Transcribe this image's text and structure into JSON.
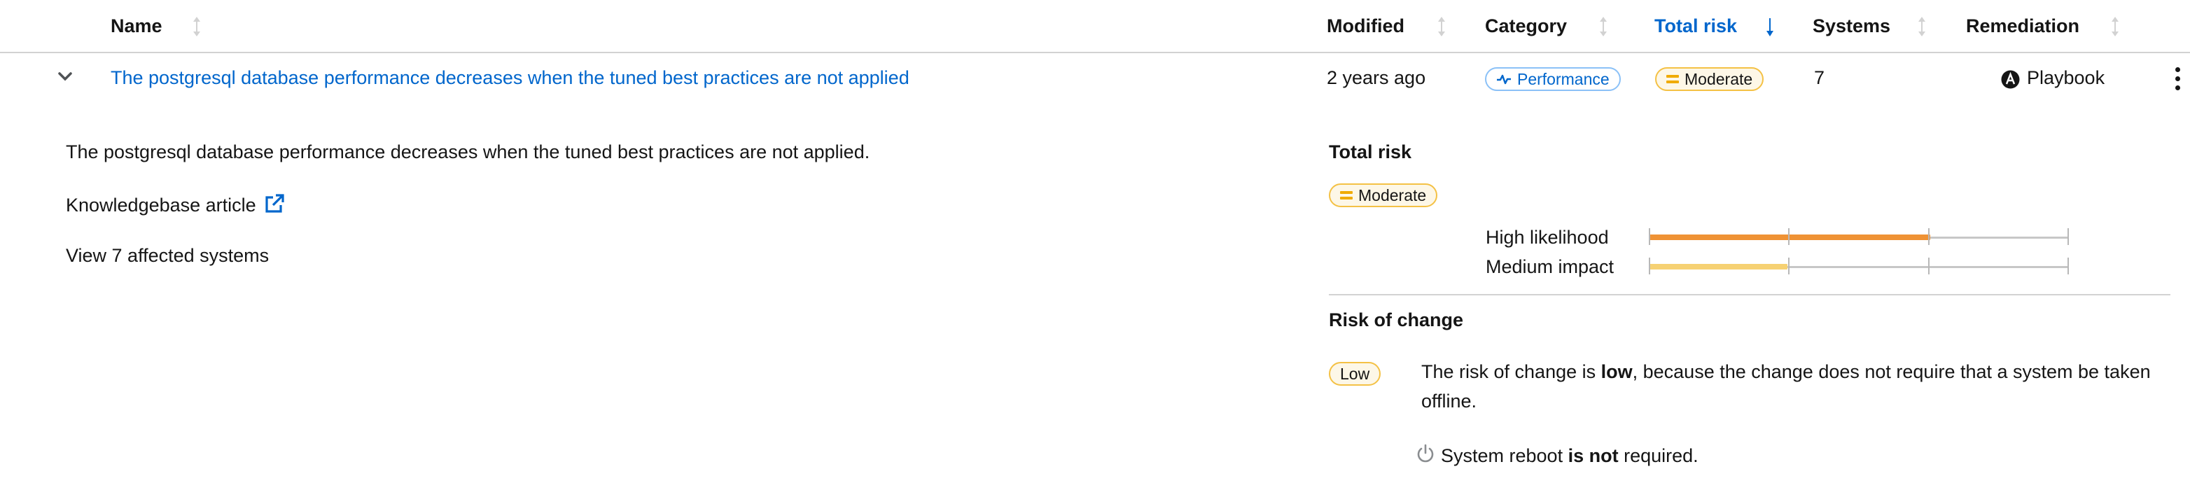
{
  "table": {
    "columns": {
      "name": "Name",
      "modified": "Modified",
      "category": "Category",
      "total_risk": "Total risk",
      "systems": "Systems",
      "remediation": "Remediation"
    },
    "sorted_column": "Total risk",
    "sort_direction": "descending"
  },
  "row": {
    "title": "The postgresql database performance decreases when the tuned best practices are not applied",
    "modified": "2 years ago",
    "category": "Performance",
    "total_risk": "Moderate",
    "systems": "7",
    "remediation": "Playbook",
    "expanded": true
  },
  "details": {
    "description": "The postgresql database performance decreases when the tuned best practices are not applied.",
    "kb_link": "Knowledgebase article",
    "affected_link": "View 7 affected systems",
    "total_risk_title": "Total risk",
    "total_risk_badge": "Moderate",
    "likelihood_label": "High likelihood",
    "impact_label": "Medium impact",
    "likelihood_level": 0.67,
    "impact_level": 0.33,
    "likelihood_color": "#ef9234",
    "impact_color": "#f6d173",
    "risk_of_change_title": "Risk of change",
    "risk_of_change_badge": "Low",
    "change_text_before": "The risk of change is ",
    "change_text_bold": "low",
    "change_text_after": ", because the change does not require that a system be taken",
    "change_text_line2": "offline.",
    "reboot_before": "System reboot ",
    "reboot_bold": "is not",
    "reboot_after": " required."
  },
  "colors": {
    "link": "#0066cc",
    "moderate_border": "#f4c145",
    "moderate_bg": "#fdf7e7"
  },
  "icons": [
    "sort-icon",
    "sort-down-icon",
    "chevron-down-icon",
    "activity-icon",
    "ansible-icon",
    "kebab-icon",
    "external-link-icon",
    "power-icon"
  ]
}
